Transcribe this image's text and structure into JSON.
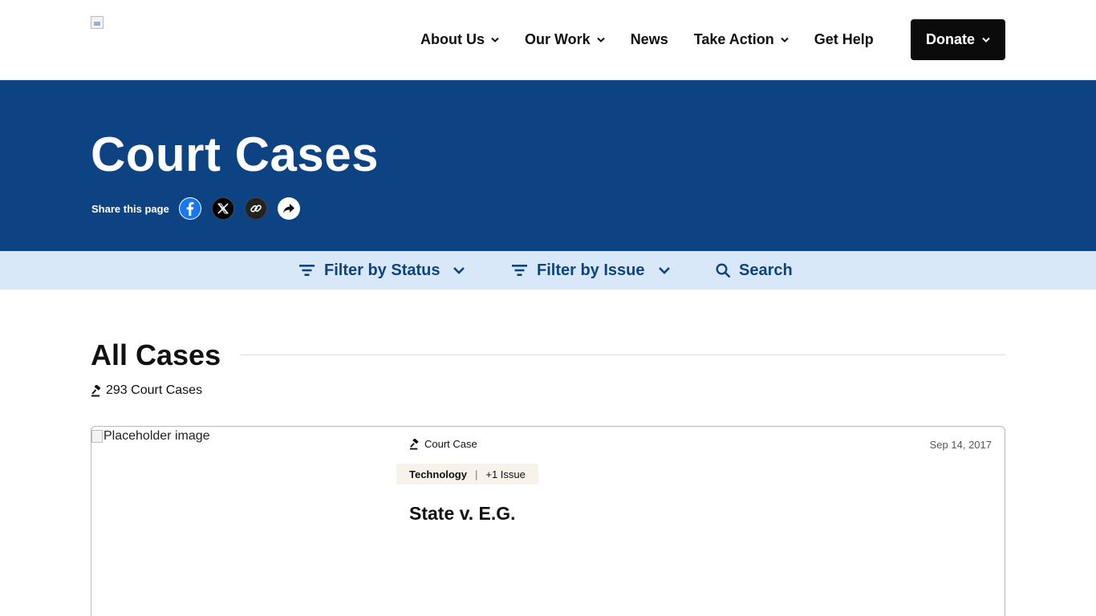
{
  "header": {
    "logo_alt": "",
    "nav": [
      {
        "label": "About Us",
        "has_dropdown": true
      },
      {
        "label": "Our Work",
        "has_dropdown": true
      },
      {
        "label": "News",
        "has_dropdown": false
      },
      {
        "label": "Take Action",
        "has_dropdown": true
      },
      {
        "label": "Get Help",
        "has_dropdown": false
      }
    ],
    "donate_label": "Donate"
  },
  "hero": {
    "title": "Court Cases",
    "share_label": "Share this page",
    "share_buttons": [
      "facebook-icon",
      "x-icon",
      "link-icon",
      "share-forward-icon"
    ]
  },
  "filters": {
    "status_label": "Filter by Status",
    "issue_label": "Filter by Issue",
    "search_label": "Search"
  },
  "section": {
    "title": "All Cases",
    "count_text": "293 Court Cases"
  },
  "cards": [
    {
      "image_alt": "Placeholder image",
      "type": "Court Case",
      "date": "Sep 14, 2017",
      "tag_primary": "Technology",
      "tag_more": "+1 Issue",
      "title": "State v. E.G."
    }
  ],
  "colors": {
    "brand_blue": "#0e4383",
    "filter_bar": "#d9e8f9",
    "donate_bg": "#0b0b0b",
    "tag_bg": "#f7f3ea"
  }
}
